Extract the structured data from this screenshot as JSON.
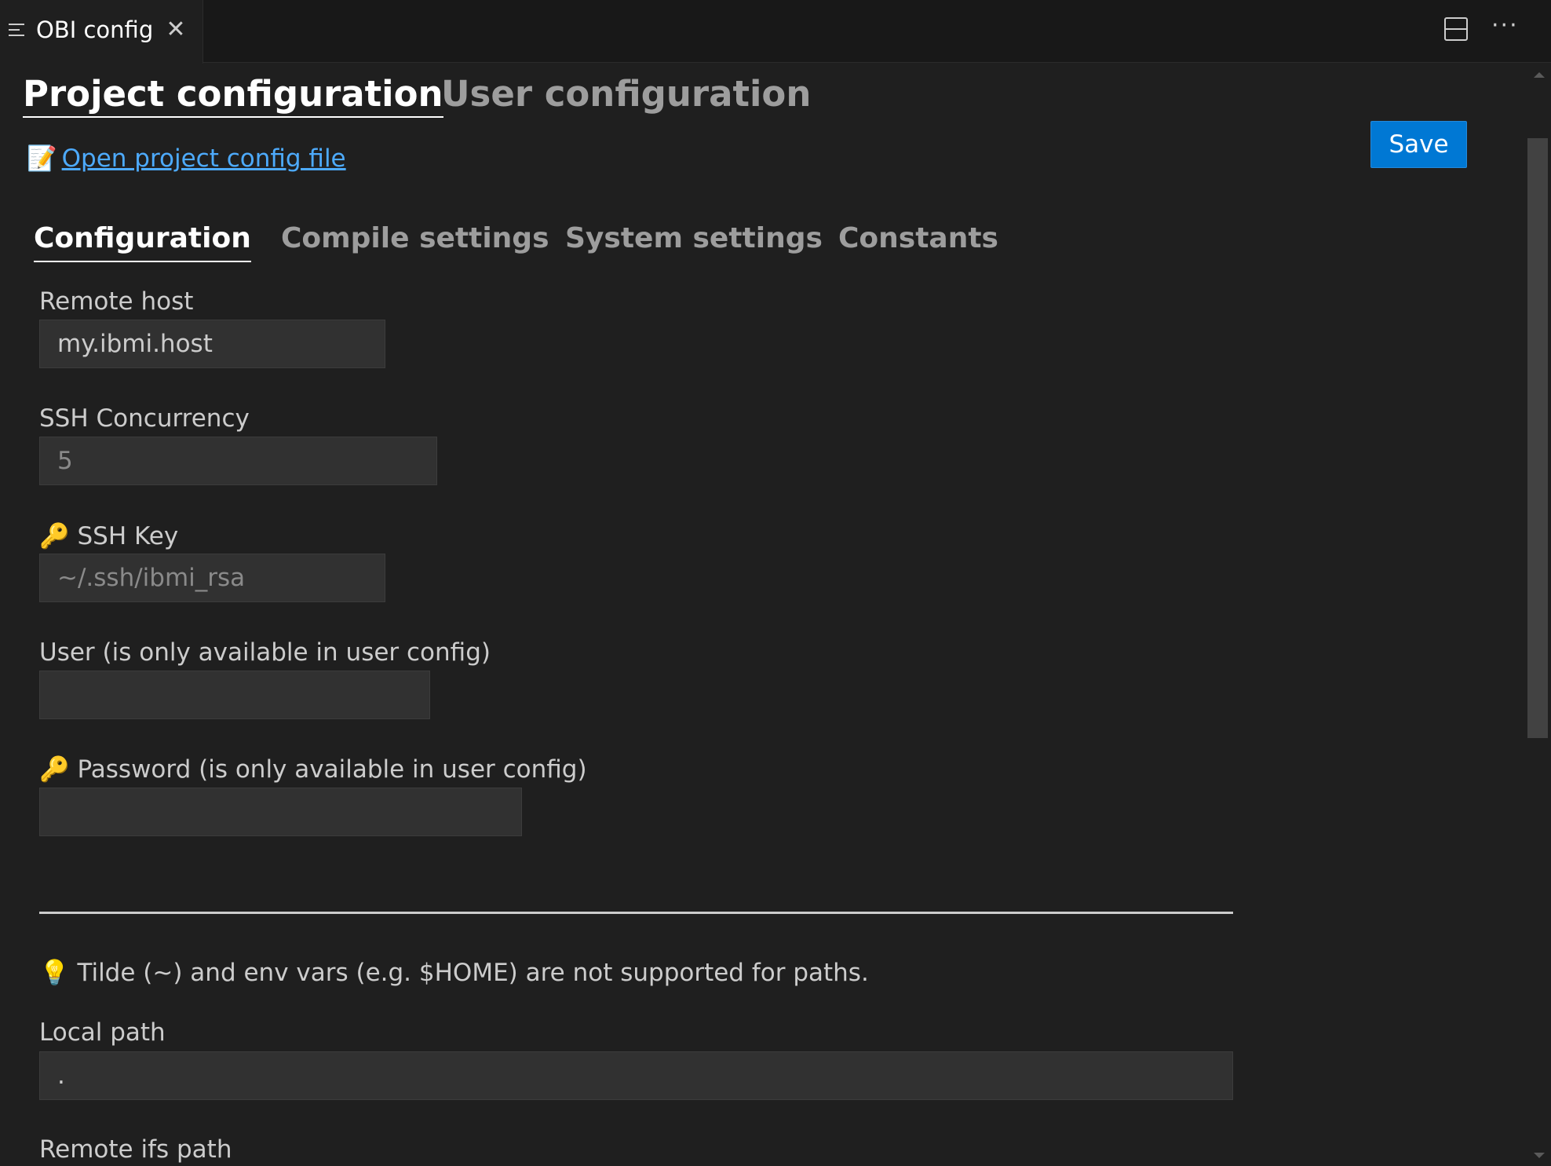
{
  "editor_tab": {
    "title": "OBI config",
    "close_glyph": "✕"
  },
  "toolbar": {
    "more_glyph": "···"
  },
  "main_tabs": [
    {
      "label": "Project configuration"
    },
    {
      "label": "User configuration"
    }
  ],
  "save_label": "Save",
  "open_config": {
    "emoji": "📝",
    "label": "Open project config file"
  },
  "sub_tabs": [
    {
      "label": "Configuration"
    },
    {
      "label": "Compile settings"
    },
    {
      "label": "System settings"
    },
    {
      "label": "Constants"
    }
  ],
  "fields": {
    "remote_host": {
      "label": "Remote host",
      "value": "my.ibmi.host"
    },
    "ssh_concurrency": {
      "label": "SSH Concurrency",
      "placeholder": "5"
    },
    "ssh_key": {
      "emoji": "🔑",
      "label": "SSH Key",
      "placeholder": "~/.ssh/ibmi_rsa"
    },
    "user": {
      "label": "User (is only available in user config)",
      "value": ""
    },
    "password": {
      "emoji": "🔑",
      "label": "Password (is only available in user config)",
      "value": ""
    },
    "local_path": {
      "label": "Local path",
      "value": "."
    },
    "remote_ifs_path": {
      "label": "Remote ifs path"
    }
  },
  "tip": {
    "emoji": "💡",
    "text": "Tilde (~) and env vars (e.g. $HOME) are not supported for paths."
  }
}
